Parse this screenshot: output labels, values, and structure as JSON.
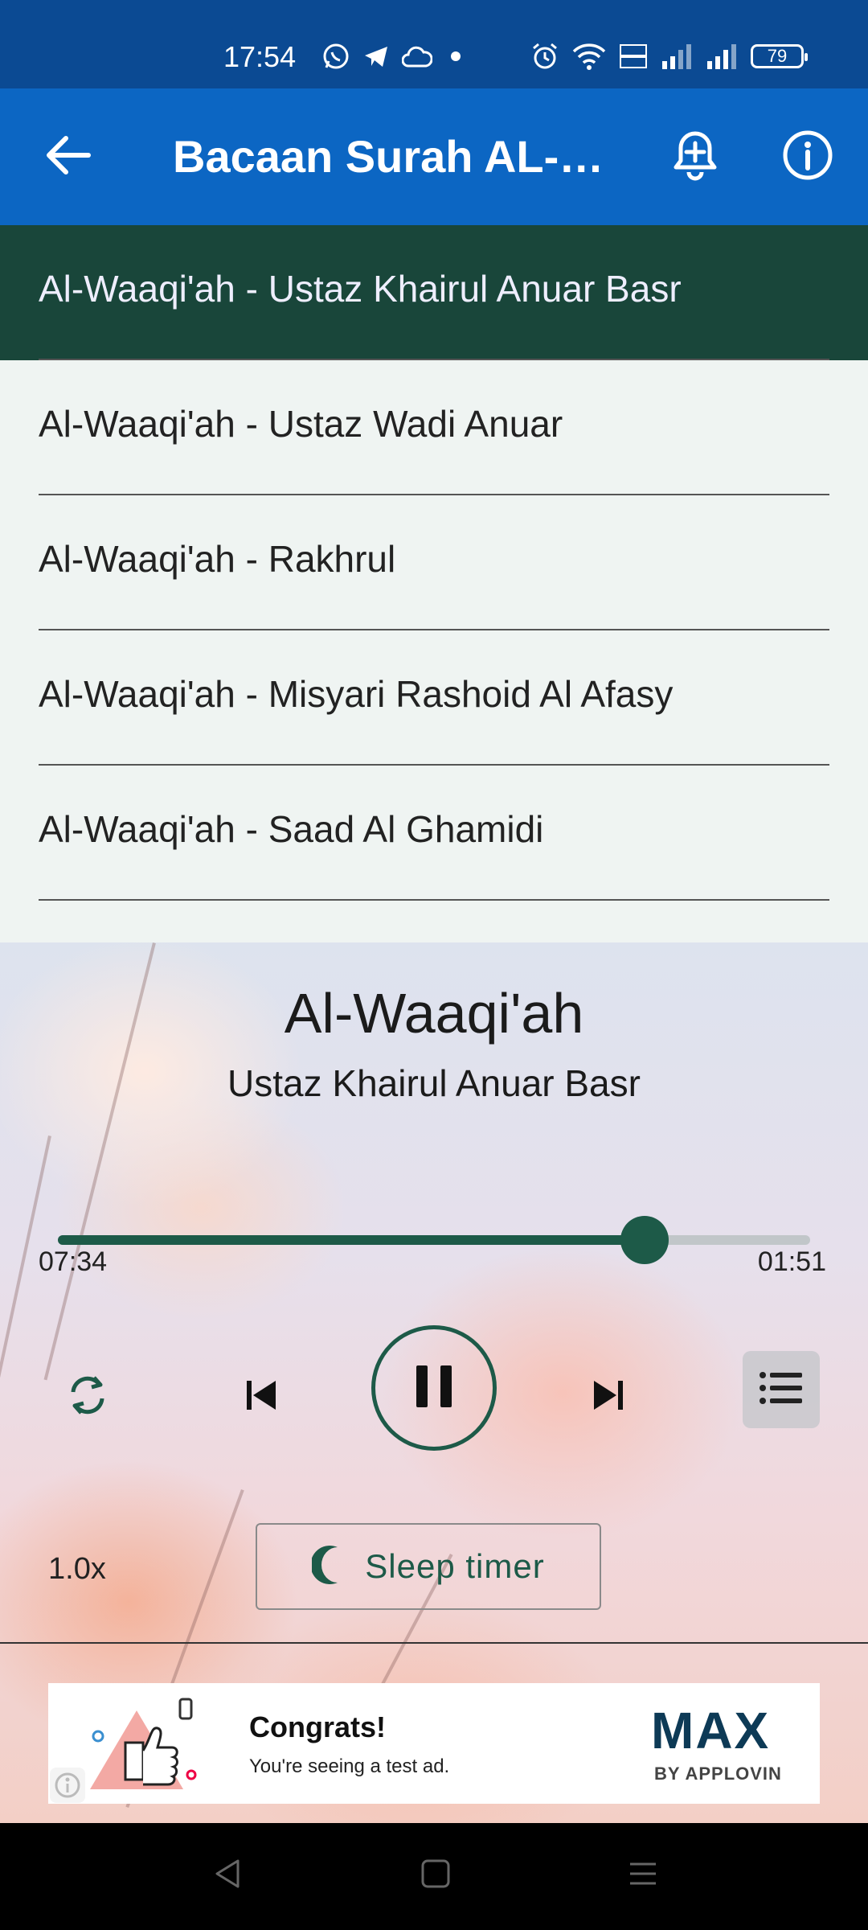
{
  "status_bar": {
    "time": "17:54",
    "battery": "79",
    "icons": [
      "whatsapp-icon",
      "telegram-icon",
      "cloud-icon",
      "dot-icon",
      "alarm-icon",
      "wifi-icon",
      "volte-icon",
      "signal-icon",
      "signal-icon",
      "battery-icon"
    ]
  },
  "app_bar": {
    "title": "Bacaan Surah AL-Waaqi'ah",
    "icons": [
      "back-arrow-icon",
      "bell-add-icon",
      "info-icon"
    ],
    "color": "#0c66c3"
  },
  "playlist": {
    "items": [
      {
        "label": "Al-Waaqi'ah - Ustaz Khairul Anuar Basr",
        "active": true
      },
      {
        "label": "Al-Waaqi'ah - Ustaz Wadi Anuar",
        "active": false
      },
      {
        "label": "Al-Waaqi'ah - Rakhrul",
        "active": false
      },
      {
        "label": "Al-Waaqi'ah - Misyari Rashoid Al Afasy",
        "active": false
      },
      {
        "label": "Al-Waaqi'ah - Saad Al Ghamidi",
        "active": false
      }
    ],
    "active_color": "#19463a"
  },
  "player": {
    "title": "Al-Waaqi'ah",
    "artist": "Ustaz Khairul Anuar Basr",
    "progress": 0.78,
    "time_elapsed": "07:34",
    "time_remaining": "01:51",
    "speed": "1.0x",
    "sleep_timer_label": "Sleep timer",
    "accent_color": "#1d5a48",
    "controls": [
      "repeat-icon",
      "skip-previous-icon",
      "pause-icon",
      "skip-next-icon",
      "queue-list-icon",
      "moon-icon"
    ]
  },
  "ad": {
    "title": "Congrats!",
    "subtitle": "You're seeing a test ad.",
    "brand": "MAX",
    "brand_by": "BY APPLOVIN"
  },
  "nav_bar": {
    "icons": [
      "back-triangle-icon",
      "home-square-icon",
      "recents-menu-icon"
    ]
  }
}
